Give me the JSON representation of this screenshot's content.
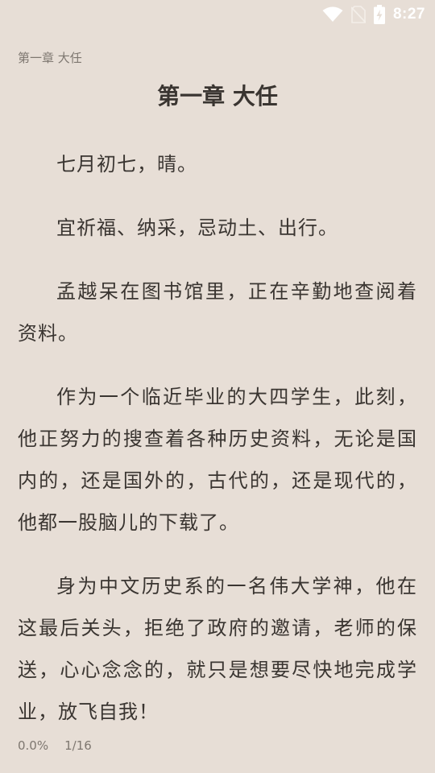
{
  "status_bar": {
    "icons": [
      "wifi-icon",
      "no-sim-icon",
      "battery-charging-icon"
    ],
    "time": "8:27"
  },
  "reader": {
    "header_chapter": "第一章 大任",
    "chapter_title": "第一章 大任",
    "paragraphs": [
      "七月初七，晴。",
      "宜祈福、纳采，忌动土、出行。",
      "孟越呆在图书馆里，正在辛勤地查阅着资料。",
      "作为一个临近毕业的大四学生，此刻，他正努力的搜查着各种历史资料，无论是国内的，还是国外的，古代的，还是现代的，他都一股脑儿的下载了。",
      "身为中文历史系的一名伟大学神，他在这最后关头，拒绝了政府的邀请，老师的保送，心心念念的，就只是想要尽快地完成学业，放飞自我！"
    ],
    "footer": {
      "progress": "0.0%",
      "page": "1/16"
    }
  }
}
